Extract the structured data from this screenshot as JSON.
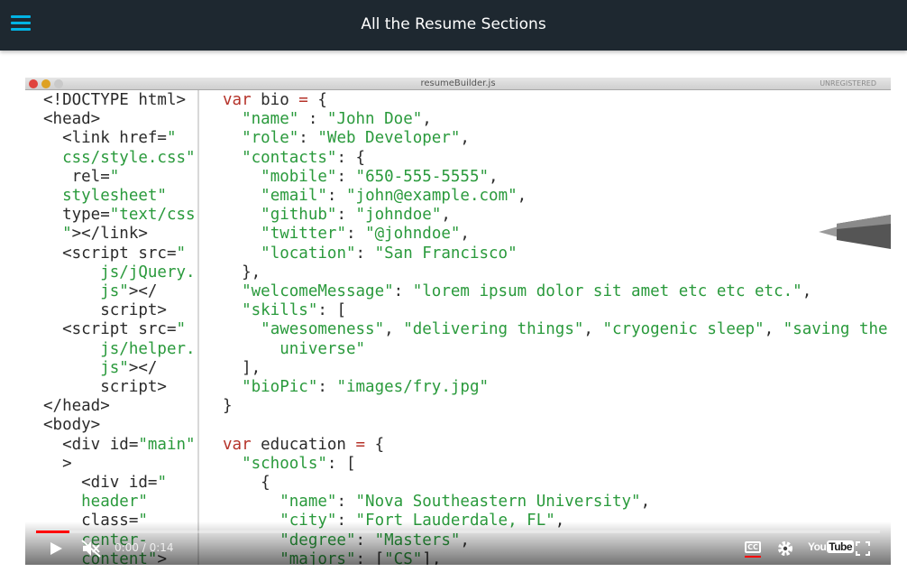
{
  "header": {
    "title": "All the Resume Sections",
    "menu_icon": "hamburger-menu-icon"
  },
  "editor": {
    "filename": "resumeBuilder.js",
    "license": "UNREGISTERED",
    "left_lines": [
      [
        [
          "tag",
          "<!DOCTYPE html>"
        ]
      ],
      [
        [
          "tag",
          "<head>"
        ]
      ],
      [
        [
          "tag",
          "  <link href="
        ],
        [
          "str",
          "\""
        ]
      ],
      [
        [
          "str",
          "  css/style.css\""
        ]
      ],
      [
        [
          "tag",
          "   rel="
        ],
        [
          "str",
          "\""
        ]
      ],
      [
        [
          "str",
          "  stylesheet\""
        ]
      ],
      [
        [
          "tag",
          "  type="
        ],
        [
          "str",
          "\"text/css"
        ]
      ],
      [
        [
          "str",
          "  \""
        ],
        [
          "tag",
          "></link>"
        ]
      ],
      [
        [
          "tag",
          "  <script src="
        ],
        [
          "str",
          "\""
        ]
      ],
      [
        [
          "str",
          "      js/jQuery."
        ]
      ],
      [
        [
          "str",
          "      js\""
        ],
        [
          "tag",
          "></"
        ]
      ],
      [
        [
          "tag",
          "      script>"
        ]
      ],
      [
        [
          "tag",
          "  <script src="
        ],
        [
          "str",
          "\""
        ]
      ],
      [
        [
          "str",
          "      js/helper."
        ]
      ],
      [
        [
          "str",
          "      js\""
        ],
        [
          "tag",
          "></"
        ]
      ],
      [
        [
          "tag",
          "      script>"
        ]
      ],
      [
        [
          "tag",
          "</head>"
        ]
      ],
      [
        [
          "tag",
          "<body>"
        ]
      ],
      [
        [
          "tag",
          "  <div id="
        ],
        [
          "str",
          "\"main\""
        ]
      ],
      [
        [
          "tag",
          "  >"
        ]
      ],
      [
        [
          "tag",
          "    <div id="
        ],
        [
          "str",
          "\""
        ]
      ],
      [
        [
          "str",
          "    header\""
        ]
      ],
      [
        [
          "tag",
          "    class="
        ],
        [
          "str",
          "\""
        ]
      ],
      [
        [
          "str",
          "    center-"
        ]
      ],
      [
        [
          "str",
          "    content\""
        ],
        [
          "tag",
          ">"
        ]
      ]
    ],
    "right_lines": [
      [
        [
          "kw",
          "var"
        ],
        [
          "tag",
          " bio "
        ],
        [
          "kw",
          "="
        ],
        [
          "tag",
          " {"
        ]
      ],
      [
        [
          "tag",
          "  "
        ],
        [
          "str",
          "\"name\""
        ],
        [
          "tag",
          " : "
        ],
        [
          "str",
          "\"John Doe\""
        ],
        [
          "tag",
          ","
        ]
      ],
      [
        [
          "tag",
          "  "
        ],
        [
          "str",
          "\"role\""
        ],
        [
          "tag",
          ": "
        ],
        [
          "str",
          "\"Web Developer\""
        ],
        [
          "tag",
          ","
        ]
      ],
      [
        [
          "tag",
          "  "
        ],
        [
          "str",
          "\"contacts\""
        ],
        [
          "tag",
          ": {"
        ]
      ],
      [
        [
          "tag",
          "    "
        ],
        [
          "str",
          "\"mobile\""
        ],
        [
          "tag",
          ": "
        ],
        [
          "str",
          "\"650-555-5555\""
        ],
        [
          "tag",
          ","
        ]
      ],
      [
        [
          "tag",
          "    "
        ],
        [
          "str",
          "\"email\""
        ],
        [
          "tag",
          ": "
        ],
        [
          "str",
          "\"john@example.com\""
        ],
        [
          "tag",
          ","
        ]
      ],
      [
        [
          "tag",
          "    "
        ],
        [
          "str",
          "\"github\""
        ],
        [
          "tag",
          ": "
        ],
        [
          "str",
          "\"johndoe\""
        ],
        [
          "tag",
          ","
        ]
      ],
      [
        [
          "tag",
          "    "
        ],
        [
          "str",
          "\"twitter\""
        ],
        [
          "tag",
          ": "
        ],
        [
          "str",
          "\"@johndoe\""
        ],
        [
          "tag",
          ","
        ]
      ],
      [
        [
          "tag",
          "    "
        ],
        [
          "str",
          "\"location\""
        ],
        [
          "tag",
          ": "
        ],
        [
          "str",
          "\"San Francisco\""
        ]
      ],
      [
        [
          "tag",
          "  },"
        ]
      ],
      [
        [
          "tag",
          "  "
        ],
        [
          "str",
          "\"welcomeMessage\""
        ],
        [
          "tag",
          ": "
        ],
        [
          "str",
          "\"lorem ipsum dolor sit amet etc etc etc.\""
        ],
        [
          "tag",
          ","
        ]
      ],
      [
        [
          "tag",
          "  "
        ],
        [
          "str",
          "\"skills\""
        ],
        [
          "tag",
          ": ["
        ]
      ],
      [
        [
          "tag",
          "    "
        ],
        [
          "str",
          "\"awesomeness\""
        ],
        [
          "tag",
          ", "
        ],
        [
          "str",
          "\"delivering things\""
        ],
        [
          "tag",
          ", "
        ],
        [
          "str",
          "\"cryogenic sleep\""
        ],
        [
          "tag",
          ", "
        ],
        [
          "str",
          "\"saving the"
        ]
      ],
      [
        [
          "str",
          "      universe\""
        ]
      ],
      [
        [
          "tag",
          "  ],"
        ]
      ],
      [
        [
          "tag",
          "  "
        ],
        [
          "str",
          "\"bioPic\""
        ],
        [
          "tag",
          ": "
        ],
        [
          "str",
          "\"images/fry.jpg\""
        ]
      ],
      [
        [
          "tag",
          "}"
        ]
      ],
      [
        [
          "tag",
          ""
        ]
      ],
      [
        [
          "kw",
          "var"
        ],
        [
          "tag",
          " education "
        ],
        [
          "kw",
          "="
        ],
        [
          "tag",
          " {"
        ]
      ],
      [
        [
          "tag",
          "  "
        ],
        [
          "str",
          "\"schools\""
        ],
        [
          "tag",
          ": ["
        ]
      ],
      [
        [
          "tag",
          "    {"
        ]
      ],
      [
        [
          "tag",
          "      "
        ],
        [
          "str",
          "\"name\""
        ],
        [
          "tag",
          ": "
        ],
        [
          "str",
          "\"Nova Southeastern University\""
        ],
        [
          "tag",
          ","
        ]
      ],
      [
        [
          "tag",
          "      "
        ],
        [
          "str",
          "\"city\""
        ],
        [
          "tag",
          ": "
        ],
        [
          "str",
          "\"Fort Lauderdale, FL\""
        ],
        [
          "tag",
          ","
        ]
      ],
      [
        [
          "tag",
          "      "
        ],
        [
          "str",
          "\"degree\""
        ],
        [
          "tag",
          ": "
        ],
        [
          "str",
          "\"Masters\""
        ],
        [
          "tag",
          ","
        ]
      ],
      [
        [
          "tag",
          "      "
        ],
        [
          "str",
          "\"majors\""
        ],
        [
          "tag",
          ": ["
        ],
        [
          "str",
          "\"CS\""
        ],
        [
          "tag",
          "],"
        ]
      ]
    ]
  },
  "player": {
    "time_display": "0:00 / 0:14",
    "progress": 0.04,
    "buttons": [
      "play-icon",
      "mute-icon",
      "closed-captions-icon",
      "settings-gear-icon",
      "youtube-logo",
      "fullscreen-icon"
    ],
    "cc_label": "CC",
    "youtube_you": "You",
    "youtube_tube": "Tube",
    "colors": {
      "accent": "#ff0000",
      "header_bg": "#1e2830",
      "menu": "#02b3e4"
    }
  }
}
